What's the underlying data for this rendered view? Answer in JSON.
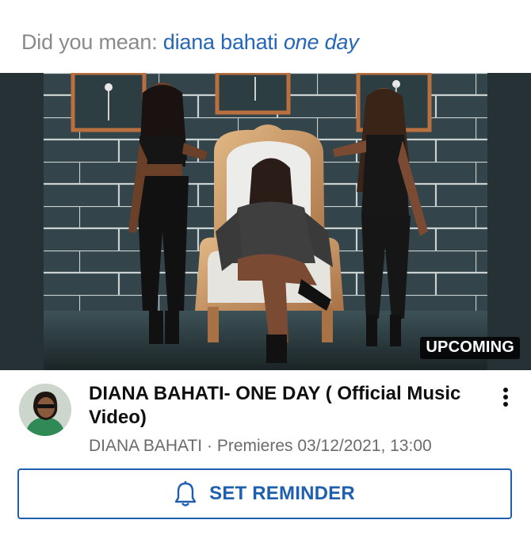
{
  "suggestion": {
    "prefix": "Did you mean: ",
    "query_plain": "diana bahati",
    "query_italic": "one day"
  },
  "video": {
    "badge": "UPCOMING",
    "title": "DIANA BAHATI- ONE DAY ( Official Music Video)",
    "channel": "DIANA BAHATI",
    "separator": " · ",
    "premiere": "Premieres 03/12/2021, 13:00"
  },
  "actions": {
    "reminder_label": "SET REMINDER",
    "reminder_icon": "bell-icon",
    "more_icon": "more-vert-icon"
  },
  "colors": {
    "link": "#2566b8",
    "button": "#1f5fb0",
    "muted": "#6b6b6b"
  }
}
